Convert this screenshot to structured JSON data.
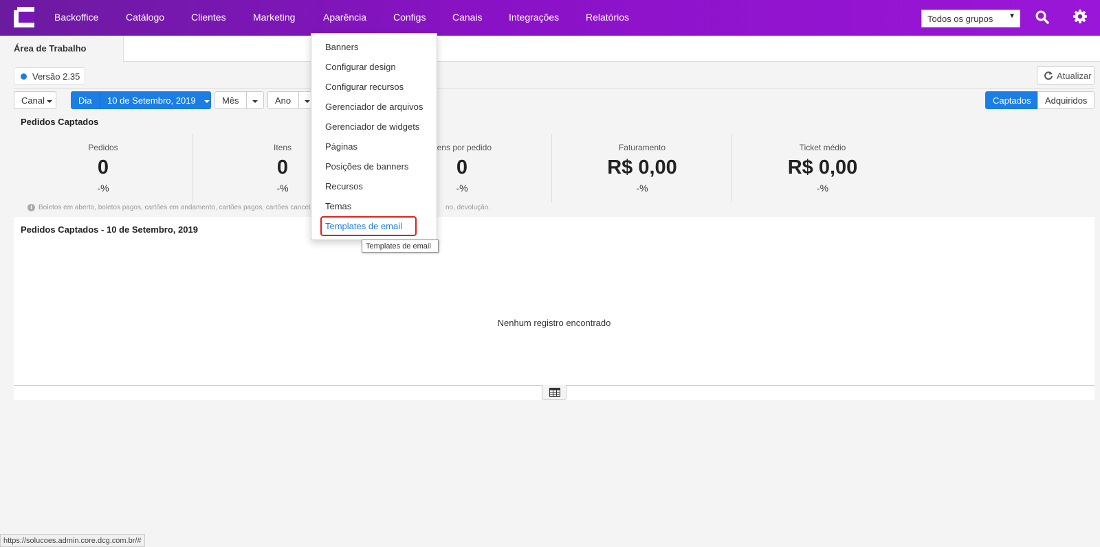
{
  "nav": {
    "items": [
      "Backoffice",
      "Catálogo",
      "Clientes",
      "Marketing",
      "Aparência",
      "Configs",
      "Canais",
      "Integrações",
      "Relatórios"
    ],
    "group_select": "Todos os grupos",
    "icons": [
      "logo-icon",
      "search-icon",
      "gear-icon"
    ]
  },
  "tabs": {
    "active": "Área de Trabalho"
  },
  "version": "Versão 2.35",
  "refresh_label": "Atualizar",
  "filters": {
    "canal": "Canal",
    "dia": "Dia",
    "date": "10 de Setembro, 2019",
    "mes": "Mês",
    "ano": "Ano",
    "captados": "Captados",
    "adquiridos": "Adquiridos"
  },
  "section_title": "Pedidos Captados",
  "stats": [
    {
      "label": "Pedidos",
      "value": "0",
      "pct": "-%"
    },
    {
      "label": "Itens",
      "value": "0",
      "pct": "-%"
    },
    {
      "label": "Itens por pedido",
      "value": "0",
      "pct": "-%"
    },
    {
      "label": "Faturamento",
      "value": "R$ 0,00",
      "pct": "-%"
    },
    {
      "label": "Ticket médio",
      "value": "R$ 0,00",
      "pct": "-%"
    }
  ],
  "info_note": "Boletos em aberto, boletos pagos, cartões em andamento, cartões pagos, cartões cancelados, bo",
  "info_note_tail": "no, devolução.",
  "chart_title": "Pedidos Captados - 10 de Setembro, 2019",
  "empty_message": "Nenhum registro encontrado",
  "menu": {
    "items": [
      "Banners",
      "Configurar design",
      "Configurar recursos",
      "Gerenciador de arquivos",
      "Gerenciador de widgets",
      "Páginas",
      "Posições de banners",
      "Recursos",
      "Temas",
      "Templates de email"
    ],
    "tooltip": "Templates de email"
  },
  "status_url": "https://solucoes.admin.core.dcg.com.br/#",
  "colors": {
    "accent": "#1a7ee6",
    "nav_start": "#6b1ba0",
    "nav_end": "#9a16d8",
    "highlight": "#e0201b"
  }
}
